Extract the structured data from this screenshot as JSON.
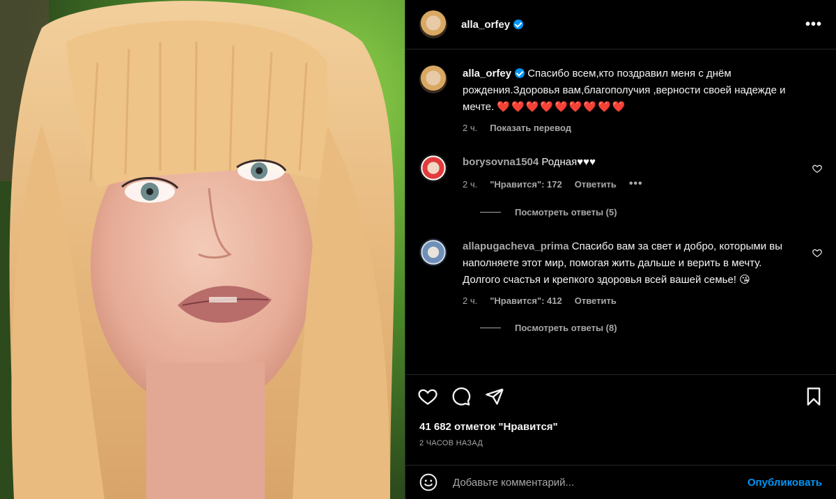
{
  "post": {
    "author": "alla_orfey",
    "caption": "Спасибо всем,кто поздравил меня с днём рождения.Здоровья вам,благополучия ,верности своей надежде и мечте.",
    "caption_hearts": "❤️❤️❤️❤️❤️❤️❤️❤️❤️",
    "caption_time": "2 ч.",
    "translate_label": "Показать перевод",
    "likes_text": "41 682 отметок \"Нравится\"",
    "posted_ago": "2 ЧАСОВ НАЗАД"
  },
  "comments": [
    {
      "username": "borysovna1504",
      "text": "Родная♥♥♥",
      "time": "2 ч.",
      "likes": "\"Нравится\": 172",
      "reply_label": "Ответить",
      "more": "•••",
      "view_replies": "Посмотреть ответы (5)"
    },
    {
      "username": "allapugacheva_prima",
      "text": "Спасибо вам за свет и добро, которыми вы наполняете этот мир, помогая жить дальше и верить в мечту. Долгого счастья и крепкого здоровья всей вашей семье! 😘",
      "time": "2 ч.",
      "likes": "\"Нравится\": 412",
      "reply_label": "Ответить",
      "view_replies": "Посмотреть ответы (8)"
    }
  ],
  "compose": {
    "placeholder": "Добавьте комментарий...",
    "post_label": "Опубликовать"
  },
  "header": {
    "more": "•••"
  },
  "colors": {
    "accent": "#0095f6",
    "heart": "#ed1c24",
    "muted": "#a8a8a8",
    "bg": "#000000"
  },
  "icons": [
    "heart-icon",
    "comment-icon",
    "share-icon",
    "bookmark-icon",
    "emoji-icon",
    "more-icon",
    "verified-icon"
  ]
}
